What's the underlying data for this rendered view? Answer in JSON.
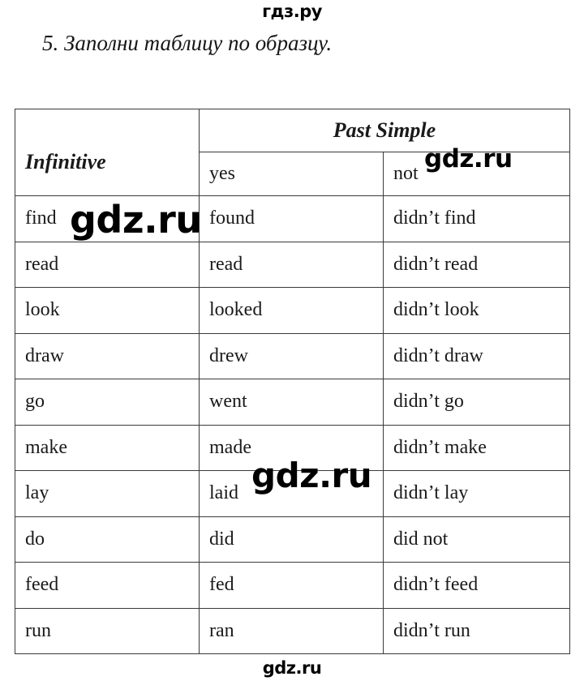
{
  "watermarks": {
    "top": "гдз.ру",
    "bottom": "gdz.ru",
    "overlay_a": "gdz.ru",
    "overlay_b": "gdz.ru",
    "overlay_c": "gdz.ru"
  },
  "heading": {
    "text": "5. Заполни таблицу по образцу."
  },
  "table": {
    "header": {
      "infinitive": "Infinitive",
      "past_simple": "Past Simple",
      "yes": "yes",
      "not": "not"
    },
    "rows": [
      {
        "infinitive": "find",
        "yes": "found",
        "not": "didn’t find"
      },
      {
        "infinitive": "read",
        "yes": "read",
        "not": "didn’t read"
      },
      {
        "infinitive": "look",
        "yes": "looked",
        "not": "didn’t look"
      },
      {
        "infinitive": "draw",
        "yes": "drew",
        "not": "didn’t draw"
      },
      {
        "infinitive": "go",
        "yes": "went",
        "not": "didn’t go"
      },
      {
        "infinitive": "make",
        "yes": "made",
        "not": "didn’t make"
      },
      {
        "infinitive": "lay",
        "yes": "laid",
        "not": "didn’t lay"
      },
      {
        "infinitive": "do",
        "yes": "did",
        "not": "did not"
      },
      {
        "infinitive": "feed",
        "yes": "fed",
        "not": "didn’t feed"
      },
      {
        "infinitive": "run",
        "yes": "ran",
        "not": "didn’t run"
      }
    ]
  },
  "colors": {
    "text": "#1a1a1a",
    "border": "#3a3a3a",
    "background": "#ffffff",
    "watermark": "#000000"
  }
}
